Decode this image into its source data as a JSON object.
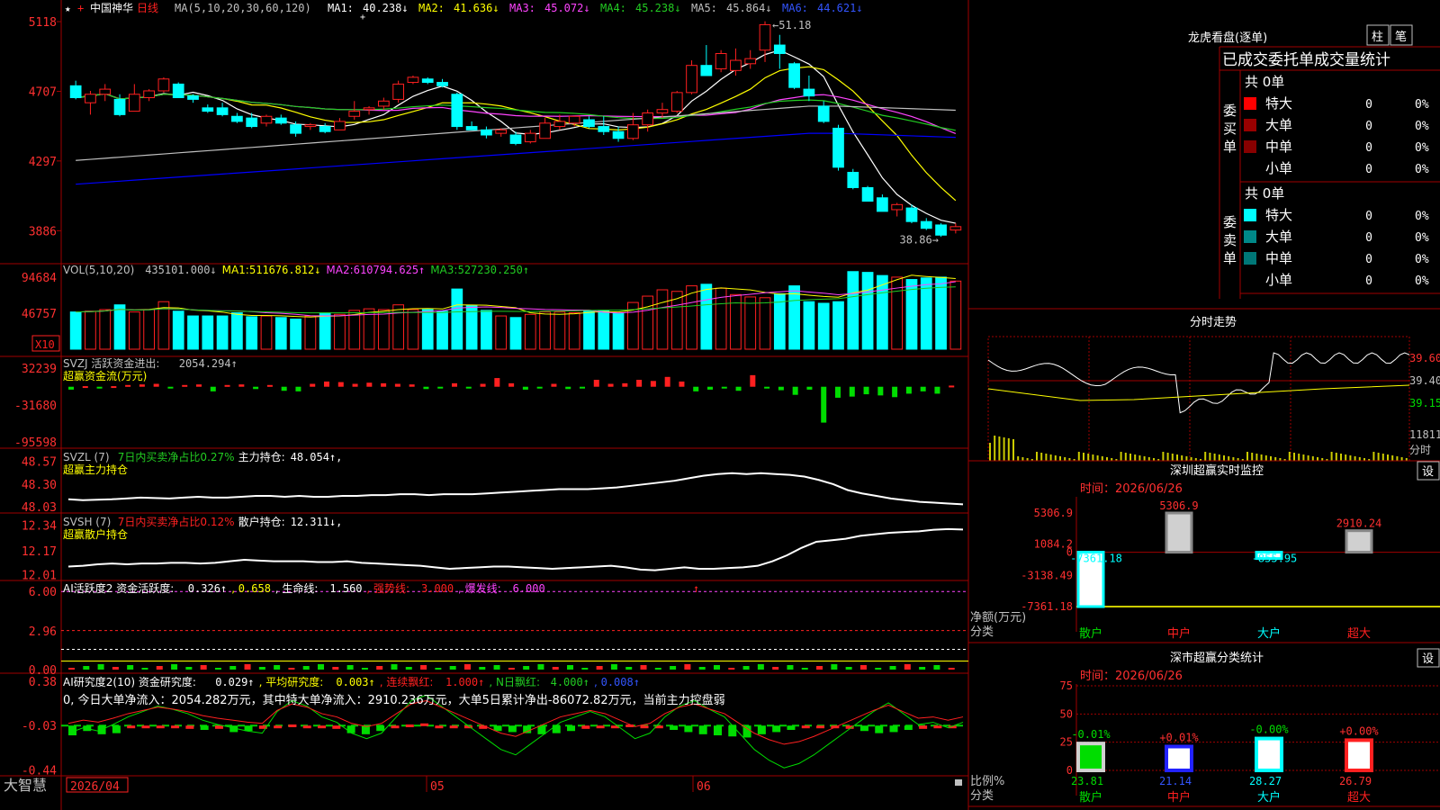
{
  "colors": {
    "up": "#ff2020",
    "down": "#00ffff",
    "ma1": "#ffffff",
    "ma2": "#ffff00",
    "ma3": "#ff44ff",
    "ma4": "#22cc22",
    "ma5": "#c0c0c0",
    "ma6": "#0000ff",
    "grid": "#a00000",
    "green": "#00dd00",
    "red": "#ff2020",
    "purple": "#ff44ff",
    "blue": "#3355ff"
  },
  "header": {
    "icons": [
      "star-icon",
      "plus-icon"
    ],
    "stock_name": "中国神华",
    "period": "日线",
    "ma_params": "MA(5,10,20,30,60,120)",
    "ma_items": [
      {
        "label": "MA1:",
        "value": "40.238↓",
        "color": "#ffffff"
      },
      {
        "label": "MA2:",
        "value": "41.636↓",
        "color": "#ffff00"
      },
      {
        "label": "MA3:",
        "value": "45.072↓",
        "color": "#ff44ff"
      },
      {
        "label": "MA4:",
        "value": "45.238↓",
        "color": "#22cc22"
      },
      {
        "label": "MA5:",
        "value": "45.864↓",
        "color": "#c0c0c0"
      },
      {
        "label": "MA6:",
        "value": "44.621↓",
        "color": "#3355ff"
      }
    ]
  },
  "chart_data": [
    {
      "type": "candlestick",
      "title": "中国神华 日线",
      "y_ticks": [
        "5118",
        "4707",
        "4297",
        "3886"
      ],
      "ylim": [
        37.5,
        51.5
      ],
      "annotations": {
        "high": "51.18",
        "low": "38.86"
      },
      "candles": [
        [
          47.4,
          47.7,
          46.6,
          46.7
        ],
        [
          46.4,
          47.1,
          45.7,
          46.9
        ],
        [
          46.9,
          47.5,
          46.5,
          47.2
        ],
        [
          46.6,
          46.9,
          45.6,
          45.7
        ],
        [
          45.9,
          47.5,
          45.9,
          46.9
        ],
        [
          46.7,
          47.2,
          46.5,
          47.1
        ],
        [
          47.1,
          47.9,
          47.0,
          47.8
        ],
        [
          47.5,
          47.6,
          46.8,
          46.7
        ],
        [
          46.8,
          46.9,
          46.4,
          46.6
        ],
        [
          46.1,
          46.3,
          45.8,
          45.9
        ],
        [
          46.1,
          46.4,
          45.6,
          45.7
        ],
        [
          45.6,
          45.8,
          45.2,
          45.3
        ],
        [
          45.5,
          45.8,
          44.9,
          45.0
        ],
        [
          45.2,
          45.7,
          45.0,
          45.6
        ],
        [
          45.5,
          45.7,
          45.1,
          45.2
        ],
        [
          45.1,
          45.3,
          44.4,
          44.6
        ],
        [
          45.0,
          45.2,
          44.8,
          45.1
        ],
        [
          45.0,
          45.2,
          44.6,
          44.7
        ],
        [
          44.8,
          45.5,
          44.8,
          45.3
        ],
        [
          45.6,
          46.5,
          45.4,
          45.9
        ],
        [
          46.0,
          46.2,
          45.7,
          46.1
        ],
        [
          46.2,
          46.7,
          46.0,
          46.5
        ],
        [
          46.6,
          47.7,
          46.4,
          47.5
        ],
        [
          47.6,
          48.0,
          47.5,
          47.9
        ],
        [
          47.8,
          47.9,
          47.5,
          47.6
        ],
        [
          47.6,
          47.8,
          47.3,
          47.4
        ],
        [
          46.9,
          47.0,
          44.8,
          45.0
        ],
        [
          45.0,
          45.3,
          44.8,
          44.8
        ],
        [
          44.8,
          45.0,
          44.3,
          44.5
        ],
        [
          44.6,
          44.9,
          44.4,
          44.8
        ],
        [
          44.5,
          44.7,
          43.9,
          44.0
        ],
        [
          44.1,
          44.8,
          44.0,
          44.6
        ],
        [
          44.3,
          45.5,
          44.3,
          45.2
        ],
        [
          45.0,
          45.7,
          44.8,
          45.3
        ],
        [
          45.2,
          45.6,
          45.0,
          45.6
        ],
        [
          45.4,
          45.6,
          44.9,
          45.0
        ],
        [
          45.0,
          45.6,
          44.5,
          44.7
        ],
        [
          44.7,
          45.0,
          44.1,
          44.3
        ],
        [
          44.3,
          45.8,
          44.2,
          45.1
        ],
        [
          45.1,
          46.0,
          44.7,
          45.8
        ],
        [
          45.8,
          46.4,
          45.5,
          46.0
        ],
        [
          45.9,
          47.1,
          45.8,
          47.0
        ],
        [
          47.0,
          48.9,
          46.9,
          48.6
        ],
        [
          48.6,
          49.8,
          48.0,
          48.0
        ],
        [
          48.4,
          49.5,
          48.2,
          49.3
        ],
        [
          48.3,
          49.6,
          48.0,
          48.9
        ],
        [
          48.7,
          49.5,
          48.4,
          49.0
        ],
        [
          49.5,
          51.2,
          48.8,
          51.0
        ],
        [
          49.8,
          50.4,
          48.4,
          49.3
        ],
        [
          48.7,
          48.8,
          47.2,
          47.3
        ],
        [
          47.2,
          48.0,
          46.5,
          46.8
        ],
        [
          46.2,
          46.5,
          45.2,
          45.3
        ],
        [
          44.9,
          45.1,
          42.4,
          42.6
        ],
        [
          42.3,
          42.5,
          41.3,
          41.4
        ],
        [
          41.4,
          41.5,
          40.6,
          40.6
        ],
        [
          40.8,
          41.0,
          40.0,
          40.0
        ],
        [
          40.1,
          40.5,
          39.7,
          40.4
        ],
        [
          40.2,
          40.4,
          39.3,
          39.4
        ],
        [
          39.4,
          39.6,
          38.9,
          39.0
        ],
        [
          39.2,
          39.3,
          38.5,
          38.6
        ],
        [
          38.9,
          39.3,
          38.7,
          39.1
        ]
      ]
    },
    {
      "type": "bar",
      "title": "VOL",
      "y_ticks": [
        "94684",
        "46757"
      ],
      "unit_badge": "X10",
      "ylim": [
        0,
        100000
      ],
      "values": [
        47000,
        48000,
        50000,
        56000,
        47000,
        50000,
        60000,
        48000,
        42000,
        42000,
        42000,
        46000,
        41000,
        42000,
        40000,
        38000,
        42000,
        46000,
        44000,
        49000,
        51000,
        50000,
        56000,
        50000,
        50000,
        48000,
        76000,
        55000,
        49000,
        42000,
        40000,
        44000,
        47000,
        47000,
        46000,
        48000,
        49000,
        45000,
        59000,
        67000,
        75000,
        73000,
        80000,
        82000,
        77000,
        69000,
        66000,
        65000,
        70000,
        80000,
        60000,
        58000,
        60000,
        98000,
        97000,
        93000,
        91000,
        88000,
        90000,
        91000,
        86000
      ],
      "legend": [
        {
          "label": "VOL(5,10,20)",
          "value": "435101.000↓",
          "color": "#c0c0c0"
        },
        {
          "label": "MA1:",
          "value": "511676.812↓",
          "color": "#ffff00"
        },
        {
          "label": "MA2:",
          "value": "610794.625↑",
          "color": "#ff44ff"
        },
        {
          "label": "MA3:",
          "value": "527230.250↑",
          "color": "#22cc22"
        }
      ]
    },
    {
      "type": "bar",
      "title": "SVZJ",
      "y_ticks": [
        "32239",
        "-31680",
        "-95598"
      ],
      "ylim": [
        -100000,
        40000
      ],
      "values": [
        -5000,
        1000,
        -3000,
        1000,
        3000,
        4000,
        5000,
        -3000,
        3000,
        4000,
        -8000,
        3000,
        4000,
        -4000,
        3000,
        -7000,
        -8000,
        5000,
        9000,
        8000,
        5000,
        7000,
        6000,
        5000,
        4000,
        -4000,
        -3000,
        6000,
        -2000,
        5000,
        15000,
        6000,
        -5000,
        -3000,
        5000,
        -4000,
        -3000,
        12000,
        5000,
        6000,
        12000,
        10000,
        17000,
        9000,
        -8000,
        -5000,
        -3000,
        -7000,
        20000,
        -3000,
        -6000,
        -14000,
        -5000,
        -62000,
        -19000,
        -17000,
        -13000,
        -15000,
        -18000,
        -12000,
        -8000,
        -12000,
        2000
      ],
      "legend": [
        {
          "label": "SVZJ  活跃资金进出:",
          "value": "2054.294↑",
          "color": "#c0c0c0"
        }
      ],
      "subtitle": "超赢资金流(万元)"
    },
    {
      "type": "line",
      "title": "SVZL",
      "y_ticks": [
        "48.57",
        "48.30",
        "48.03"
      ],
      "ylim": [
        48.0,
        48.62
      ],
      "values": [
        48.12,
        48.11,
        48.115,
        48.12,
        48.13,
        48.14,
        48.135,
        48.13,
        48.14,
        48.15,
        48.14,
        48.14,
        48.15,
        48.16,
        48.16,
        48.15,
        48.16,
        48.15,
        48.15,
        48.16,
        48.16,
        48.17,
        48.17,
        48.18,
        48.18,
        48.17,
        48.18,
        48.18,
        48.18,
        48.19,
        48.2,
        48.21,
        48.22,
        48.23,
        48.24,
        48.24,
        48.24,
        48.25,
        48.26,
        48.28,
        48.3,
        48.32,
        48.34,
        48.37,
        48.4,
        48.42,
        48.43,
        48.42,
        48.43,
        48.42,
        48.41,
        48.39,
        48.35,
        48.3,
        48.23,
        48.19,
        48.16,
        48.13,
        48.11,
        48.09,
        48.08,
        48.07,
        48.06
      ],
      "legend": [
        {
          "label": "SVZL (7)",
          "value": "",
          "color": "#c0c0c0"
        },
        {
          "label": "7日内买卖净占比0.27%",
          "value": "",
          "color": "#22cc22"
        },
        {
          "label": "主力持仓:",
          "value": "48.054↑,",
          "color": "#ffffff"
        }
      ],
      "subtitle": "超赢主力持仓"
    },
    {
      "type": "line",
      "title": "SVSH",
      "y_ticks": [
        "12.34",
        "12.17",
        "12.01"
      ],
      "ylim": [
        11.99,
        12.35
      ],
      "values": [
        12.065,
        12.07,
        12.08,
        12.085,
        12.08,
        12.085,
        12.085,
        12.09,
        12.09,
        12.085,
        12.09,
        12.1,
        12.11,
        12.105,
        12.1,
        12.1,
        12.1,
        12.095,
        12.095,
        12.1,
        12.09,
        12.085,
        12.08,
        12.075,
        12.07,
        12.06,
        12.05,
        12.055,
        12.06,
        12.065,
        12.065,
        12.06,
        12.055,
        12.05,
        12.055,
        12.06,
        12.065,
        12.07,
        12.06,
        12.045,
        12.04,
        12.05,
        12.06,
        12.05,
        12.05,
        12.055,
        12.06,
        12.07,
        12.1,
        12.14,
        12.19,
        12.23,
        12.24,
        12.25,
        12.27,
        12.28,
        12.29,
        12.295,
        12.3,
        12.31,
        12.315,
        12.312
      ],
      "legend": [
        {
          "label": "SVSH (7)",
          "value": "",
          "color": "#c0c0c0"
        },
        {
          "label": "7日内买卖净占比0.12%",
          "value": "",
          "color": "#ff2020"
        },
        {
          "label": "散户持仓:",
          "value": "12.311↓,",
          "color": "#ffffff"
        }
      ],
      "subtitle": "超赢散户持仓"
    },
    {
      "type": "bar",
      "title": "AI活跃度2",
      "y_ticks": [
        "6.00",
        "2.96",
        "0.00"
      ],
      "ylim": [
        0,
        6.5
      ],
      "legend": [
        {
          "label": "AI活跃度2 资金活跃度:",
          "value": "0.326↑",
          "color": "#ffffff"
        },
        {
          "label": ",",
          "value": "0.658",
          "color": "#ffff00"
        },
        {
          "label": ", 生命线:",
          "value": "1.560",
          "color": "#ffffff"
        },
        {
          "label": ", 强势线:",
          "value": "3.000",
          "color": "#ff2020"
        },
        {
          "label": ", 爆发线:",
          "value": "6.000",
          "color": "#ff44ff"
        }
      ]
    },
    {
      "type": "line",
      "title": "AI研究度2",
      "y_ticks": [
        "0.38",
        "-0.03",
        "-0.44"
      ],
      "ylim": [
        -0.46,
        0.42
      ],
      "legend": [
        {
          "label": "AI研究度2(10) 资金研究度:",
          "value": "0.029↑",
          "color": "#ffffff"
        },
        {
          "label": ", 平均研究度:",
          "value": "0.003↑",
          "color": "#ffff00"
        },
        {
          "label": ", 连续飘红:",
          "value": "1.000↑",
          "color": "#ff2020"
        },
        {
          "label": ", N日飘红:",
          "value": "4.000↑",
          "color": "#22cc22"
        },
        {
          "label": ",",
          "value": "0.008↑",
          "color": "#3355ff"
        }
      ],
      "summary": "0, 今日大单净流入：2054.282万元，其中特大单净流入：2910.236万元，大单5日累计净出-86072.82万元，当前主力控盘弱"
    }
  ],
  "footer": {
    "brand": "大智慧",
    "dates": [
      "2026/04",
      "05",
      "06"
    ]
  },
  "lhb": {
    "title": "龙虎看盘(逐单)",
    "btn1": "柱",
    "btn2": "笔",
    "stat_title": "已成交委托单成交量统计",
    "buy": {
      "side": "委买单",
      "total": "共 0单",
      "rows": [
        {
          "label": "特大",
          "value": "0",
          "pct": "0%",
          "color": "#ff0000"
        },
        {
          "label": "大单",
          "value": "0",
          "pct": "0%",
          "color": "#990000"
        },
        {
          "label": "中单",
          "value": "0",
          "pct": "0%",
          "color": "#880000"
        },
        {
          "label": "小单",
          "value": "0",
          "pct": "0%",
          "color": ""
        }
      ]
    },
    "sell": {
      "side": "委卖单",
      "total": "共 0单",
      "rows": [
        {
          "label": "特大",
          "value": "0",
          "pct": "0%",
          "color": "#00ffff"
        },
        {
          "label": "大单",
          "value": "0",
          "pct": "0%",
          "color": "#008888"
        },
        {
          "label": "中单",
          "value": "0",
          "pct": "0%",
          "color": "#007777"
        },
        {
          "label": "小单",
          "value": "0",
          "pct": "0%",
          "color": ""
        }
      ]
    }
  },
  "fenshi": {
    "title": "分时走势",
    "y_labels": [
      "39.60",
      "39.40",
      "39.15"
    ],
    "vol_label": "11811",
    "bottom_label": "分时"
  },
  "monitor": {
    "title": "深圳超赢实时监控",
    "set": "设",
    "date": "时间：2026/06/26",
    "y_labels": [
      "5306.9",
      "1084.2",
      "0",
      "-3138.49",
      "-7361.18"
    ],
    "axis_title": "净额(万元)",
    "axis_sub": "分类",
    "categories": [
      "散户",
      "中户",
      "大户",
      "超大"
    ],
    "values": [
      -7361.18,
      5306.9,
      -855.95,
      2910.24
    ],
    "value_labels": [
      "-7361.18",
      "5306.9",
      "-855.95",
      "2910.24"
    ]
  },
  "stats": {
    "title": "深市超赢分类统计",
    "set": "设",
    "date": "时间：2026/06/26",
    "y_labels": [
      "75",
      "50",
      "25",
      "0"
    ],
    "axis_title": "比例%",
    "axis_sub": "分类",
    "categories": [
      "散户",
      "中户",
      "大户",
      "超大"
    ],
    "values": [
      23.81,
      21.14,
      28.27,
      26.79
    ],
    "value_labels": [
      "23.81",
      "21.14",
      "28.27",
      "26.79"
    ],
    "change_labels": [
      "-0.01%",
      "+0.01%",
      "-0.00%",
      "+0.00%"
    ]
  }
}
